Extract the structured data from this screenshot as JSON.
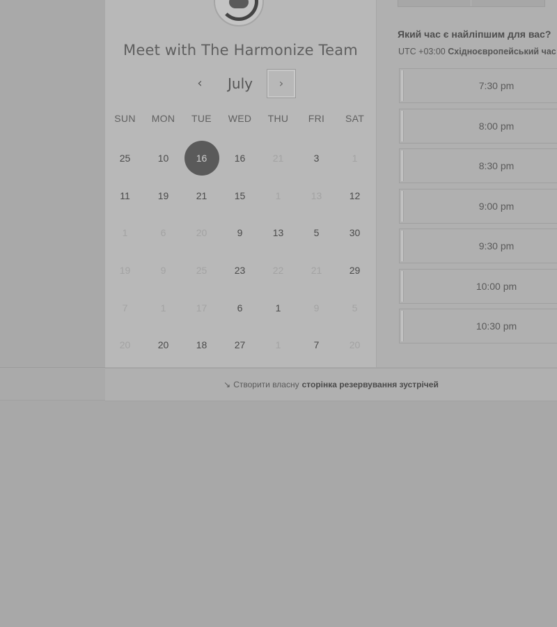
{
  "scheduler": {
    "title": "Meet with The Harmonize Team",
    "month": "July",
    "prev_icon": "chevron-left-icon",
    "next_icon": "chevron-right-icon",
    "weekdays": [
      "SUN",
      "MON",
      "TUE",
      "WED",
      "THU",
      "FRI",
      "SAT"
    ],
    "weeks": [
      [
        {
          "label": "25",
          "disabled": false
        },
        {
          "label": "10",
          "disabled": false
        },
        {
          "label": "16",
          "disabled": false,
          "selected": true
        },
        {
          "label": "16",
          "disabled": false
        },
        {
          "label": "21",
          "disabled": true
        },
        {
          "label": "3",
          "disabled": false
        },
        {
          "label": "1",
          "disabled": true
        }
      ],
      [
        {
          "label": "11",
          "disabled": false
        },
        {
          "label": "19",
          "disabled": false
        },
        {
          "label": "21",
          "disabled": false
        },
        {
          "label": "15",
          "disabled": false
        },
        {
          "label": "1",
          "disabled": true
        },
        {
          "label": "13",
          "disabled": true
        },
        {
          "label": "12",
          "disabled": false
        }
      ],
      [
        {
          "label": "1",
          "disabled": true
        },
        {
          "label": "6",
          "disabled": true
        },
        {
          "label": "20",
          "disabled": true
        },
        {
          "label": "9",
          "disabled": false
        },
        {
          "label": "13",
          "disabled": false
        },
        {
          "label": "5",
          "disabled": false
        },
        {
          "label": "30",
          "disabled": false
        }
      ],
      [
        {
          "label": "19",
          "disabled": true
        },
        {
          "label": "9",
          "disabled": true
        },
        {
          "label": "25",
          "disabled": true
        },
        {
          "label": "23",
          "disabled": false
        },
        {
          "label": "22",
          "disabled": true
        },
        {
          "label": "21",
          "disabled": true
        },
        {
          "label": "29",
          "disabled": false
        }
      ],
      [
        {
          "label": "7",
          "disabled": true
        },
        {
          "label": "1",
          "disabled": true
        },
        {
          "label": "17",
          "disabled": true
        },
        {
          "label": "6",
          "disabled": false
        },
        {
          "label": "1",
          "disabled": false
        },
        {
          "label": "9",
          "disabled": true
        },
        {
          "label": "5",
          "disabled": true
        }
      ],
      [
        {
          "label": "20",
          "disabled": true
        },
        {
          "label": "20",
          "disabled": false
        },
        {
          "label": "18",
          "disabled": false
        },
        {
          "label": "27",
          "disabled": false
        },
        {
          "label": "1",
          "disabled": true
        },
        {
          "label": "7",
          "disabled": false
        },
        {
          "label": "20",
          "disabled": true
        }
      ]
    ]
  },
  "times": {
    "question": "Який час є найліпшим для вас?",
    "tz_offset": "UTC +03:00",
    "tz_name": "Східноєвропейський час",
    "slots": [
      "7:30 pm",
      "8:00 pm",
      "8:30 pm",
      "9:00 pm",
      "9:30 pm",
      "10:00 pm",
      "10:30 pm"
    ]
  },
  "footer": {
    "icon": "wand-icon",
    "icon_glyph": "↘",
    "text": "Створити власну",
    "bold_text": "сторінка резервування зустрічей"
  }
}
